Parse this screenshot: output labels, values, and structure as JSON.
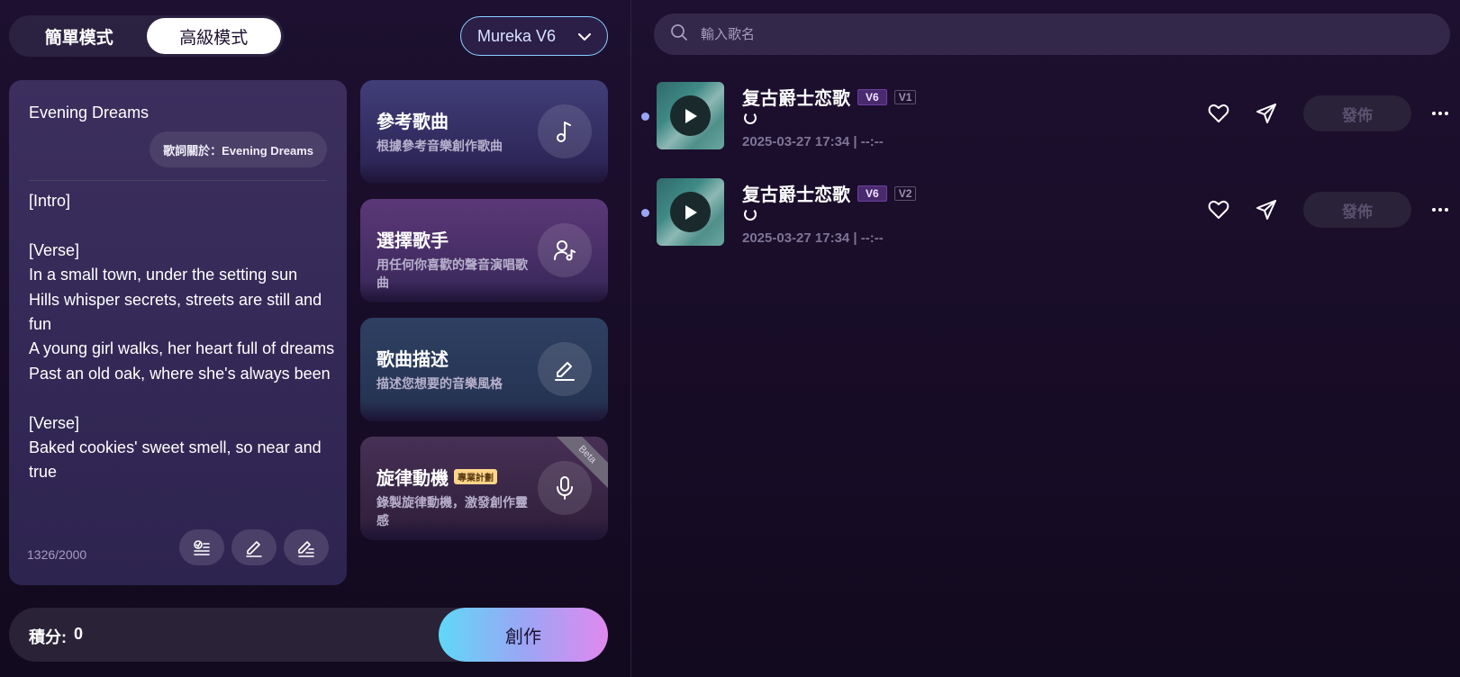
{
  "mode_toggle": {
    "simple_label": "簡單模式",
    "advanced_label": "高級模式",
    "active": "advanced"
  },
  "model_select": {
    "value": "Mureka V6"
  },
  "lyrics": {
    "title": "Evening Dreams",
    "about_label": "歌詞關於：Evening Dreams",
    "text": "[Intro]\n\n[Verse]\nIn a small town, under the setting sun\nHills whisper secrets, streets are still and fun\nA young girl walks, her heart full of dreams\nPast an old oak, where she's always been\n\n[Verse]\nBaked cookies' sweet smell, so near and true",
    "char_count": "1326/2000"
  },
  "features": [
    {
      "title": "參考歌曲",
      "subtitle": "根據參考音樂創作歌曲",
      "icon": "music-note-icon"
    },
    {
      "title": "選擇歌手",
      "subtitle": "用任何你喜歡的聲音演唱歌曲",
      "icon": "singer-icon"
    },
    {
      "title": "歌曲描述",
      "subtitle": "描述您想要的音樂風格",
      "icon": "pencil-icon"
    },
    {
      "title": "旋律動機",
      "badge": "專業計劃",
      "ribbon": "Beta",
      "subtitle": "錄製旋律動機，激發創作靈感",
      "icon": "microphone-icon"
    }
  ],
  "footer": {
    "credits_label": "積分:",
    "credits_value": "0",
    "create_label": "創作"
  },
  "search": {
    "placeholder": "輸入歌名"
  },
  "songs": [
    {
      "title": "复古爵士恋歌",
      "model_badge": "V6",
      "version_badge": "V1",
      "meta": "2025-03-27 17:34 | --:--",
      "publish_label": "發佈"
    },
    {
      "title": "复古爵士恋歌",
      "model_badge": "V6",
      "version_badge": "V2",
      "meta": "2025-03-27 17:34 | --:--",
      "publish_label": "發佈"
    }
  ],
  "colors": {
    "accent_blue": "#5fd8f7",
    "accent_pink": "#e088ee",
    "background": "#1d1030"
  }
}
